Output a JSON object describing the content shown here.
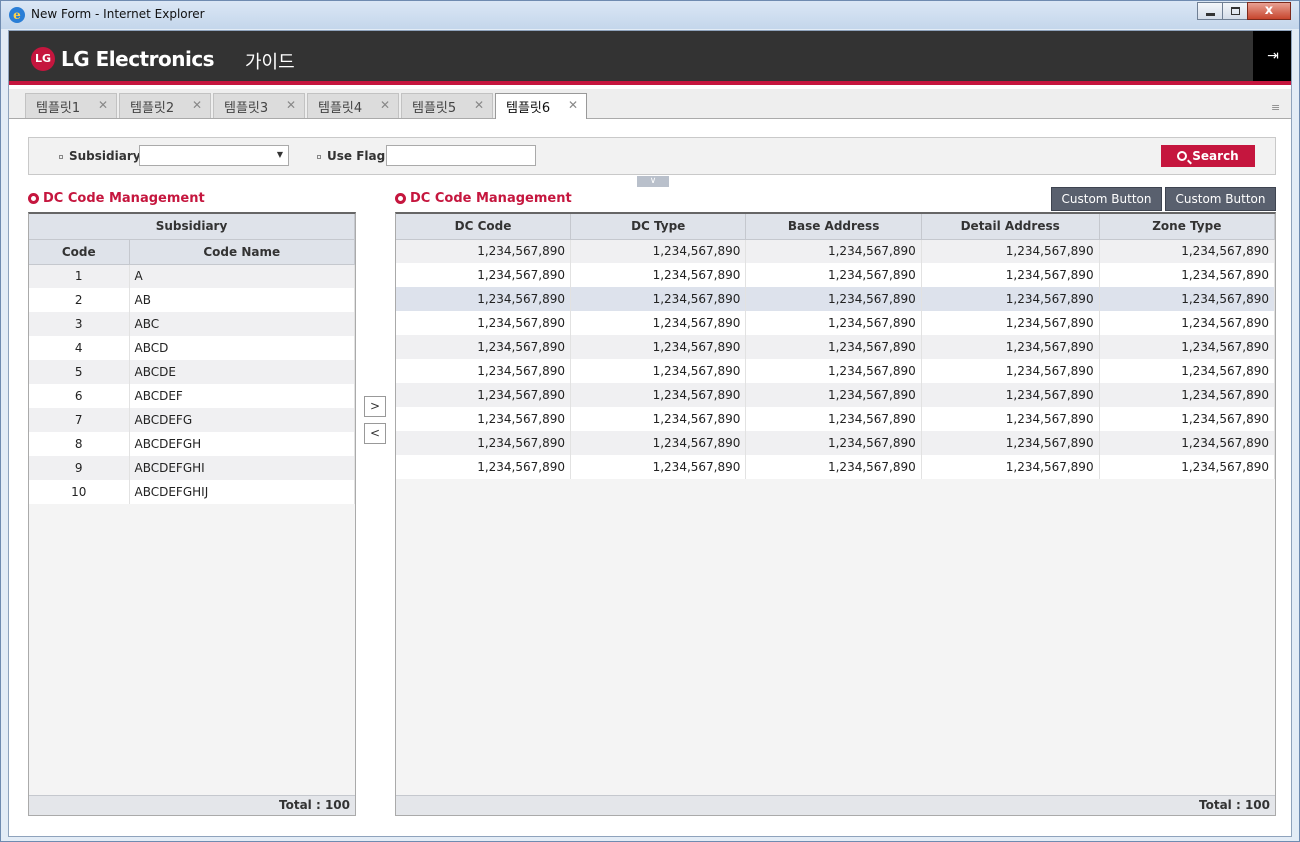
{
  "window": {
    "title": "New Form - Internet Explorer",
    "close_glyph": "x"
  },
  "header": {
    "brand": "LG Electronics",
    "logo_mark": "LG",
    "section": "가이드",
    "logout_icon": "logout-icon"
  },
  "tabs": [
    {
      "label": "템플릿1"
    },
    {
      "label": "템플릿2"
    },
    {
      "label": "템플릿3"
    },
    {
      "label": "템플릿4"
    },
    {
      "label": "템플릿5"
    },
    {
      "label": "템플릿6",
      "active": true
    }
  ],
  "search": {
    "subsidiary_label": "Subsidiary",
    "subsidiary_value": "",
    "use_flag_label": "Use Flag",
    "use_flag_value": "",
    "button_label": "Search"
  },
  "left_panel": {
    "title": "DC Code Management",
    "group_header": "Subsidiary",
    "columns": [
      "Code",
      "Code Name"
    ],
    "rows": [
      {
        "code": "1",
        "name": "A"
      },
      {
        "code": "2",
        "name": "AB"
      },
      {
        "code": "3",
        "name": "ABC"
      },
      {
        "code": "4",
        "name": "ABCD"
      },
      {
        "code": "5",
        "name": "ABCDE"
      },
      {
        "code": "6",
        "name": "ABCDEF"
      },
      {
        "code": "7",
        "name": "ABCDEFG"
      },
      {
        "code": "8",
        "name": "ABCDEFGH"
      },
      {
        "code": "9",
        "name": "ABCDEFGHI"
      },
      {
        "code": "10",
        "name": "ABCDEFGHIJ"
      }
    ],
    "total": "Total : 100"
  },
  "move_buttons": {
    "right": ">",
    "left": "<"
  },
  "right_panel": {
    "title": "DC Code Management",
    "buttons": [
      "Custom Button",
      "Custom Button"
    ],
    "columns": [
      "DC Code",
      "DC Type",
      "Base Address",
      "Detail Address",
      "Zone Type"
    ],
    "rows": [
      [
        "1,234,567,890",
        "1,234,567,890",
        "1,234,567,890",
        "1,234,567,890",
        "1,234,567,890"
      ],
      [
        "1,234,567,890",
        "1,234,567,890",
        "1,234,567,890",
        "1,234,567,890",
        "1,234,567,890"
      ],
      [
        "1,234,567,890",
        "1,234,567,890",
        "1,234,567,890",
        "1,234,567,890",
        "1,234,567,890"
      ],
      [
        "1,234,567,890",
        "1,234,567,890",
        "1,234,567,890",
        "1,234,567,890",
        "1,234,567,890"
      ],
      [
        "1,234,567,890",
        "1,234,567,890",
        "1,234,567,890",
        "1,234,567,890",
        "1,234,567,890"
      ],
      [
        "1,234,567,890",
        "1,234,567,890",
        "1,234,567,890",
        "1,234,567,890",
        "1,234,567,890"
      ],
      [
        "1,234,567,890",
        "1,234,567,890",
        "1,234,567,890",
        "1,234,567,890",
        "1,234,567,890"
      ],
      [
        "1,234,567,890",
        "1,234,567,890",
        "1,234,567,890",
        "1,234,567,890",
        "1,234,567,890"
      ],
      [
        "1,234,567,890",
        "1,234,567,890",
        "1,234,567,890",
        "1,234,567,890",
        "1,234,567,890"
      ],
      [
        "1,234,567,890",
        "1,234,567,890",
        "1,234,567,890",
        "1,234,567,890",
        "1,234,567,890"
      ]
    ],
    "selected_row": 2,
    "total": "Total : 100"
  },
  "colors": {
    "brand_red": "#c5163e",
    "header_bg": "#333333",
    "button_dark": "#59606e"
  }
}
